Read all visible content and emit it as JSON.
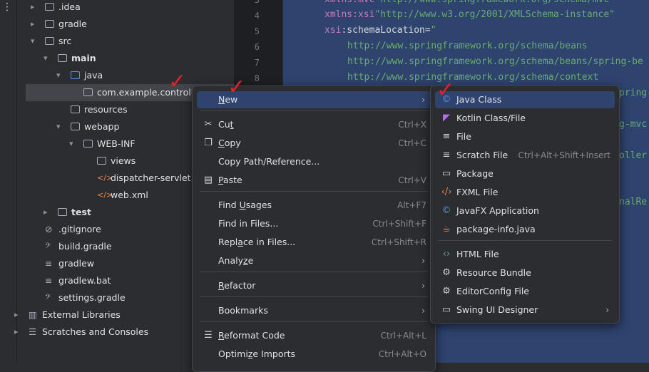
{
  "tree": [
    {
      "label": ".idea",
      "arrow": "›",
      "icon": "folder-icon"
    },
    {
      "label": "gradle",
      "arrow": "›",
      "icon": "folder-icon"
    },
    {
      "label": "src",
      "arrow": "⌄",
      "icon": "folder-icon"
    },
    {
      "label": "main",
      "arrow": "⌄",
      "icon": "folder-icon"
    },
    {
      "label": "java",
      "arrow": "⌄",
      "icon": "source-folder-icon"
    },
    {
      "label": "com.example.controll",
      "arrow": "",
      "icon": "package-icon"
    },
    {
      "label": "resources",
      "arrow": "",
      "icon": "resources-folder-icon"
    },
    {
      "label": "webapp",
      "arrow": "⌄",
      "icon": "folder-icon"
    },
    {
      "label": "WEB-INF",
      "arrow": "⌄",
      "icon": "folder-icon"
    },
    {
      "label": "views",
      "arrow": "",
      "icon": "folder-icon"
    },
    {
      "label": "dispatcher-servlet.x",
      "arrow": "",
      "icon": "xml-icon"
    },
    {
      "label": "web.xml",
      "arrow": "",
      "icon": "xml-icon"
    },
    {
      "label": "test",
      "arrow": "›",
      "icon": "folder-icon"
    },
    {
      "label": ".gitignore",
      "arrow": "",
      "icon": "gitignore-icon"
    },
    {
      "label": "build.gradle",
      "arrow": "",
      "icon": "gradle-icon"
    },
    {
      "label": "gradlew",
      "arrow": "",
      "icon": "file-icon"
    },
    {
      "label": "gradlew.bat",
      "arrow": "",
      "icon": "file-icon"
    },
    {
      "label": "settings.gradle",
      "arrow": "",
      "icon": "gradle-icon"
    },
    {
      "label": "External Libraries",
      "arrow": "›",
      "icon": "library-icon"
    },
    {
      "label": "Scratches and Consoles",
      "arrow": "›",
      "icon": "scratches-icon"
    }
  ],
  "gutter": [
    "3",
    "4",
    "5",
    "6",
    "7",
    "8"
  ],
  "code": [
    {
      "attr": "xmlns:",
      "name": "mvc",
      "val": "\"http://www.springframework.org/schema/mvc\""
    },
    {
      "attr": "xmlns:",
      "name": "xsi",
      "val": "\"http://www.w3.org/2001/XMLSchema-instance\""
    },
    {
      "attr": "xsi",
      "name": ":schemaLocation=",
      "val": "\""
    },
    {
      "attr": "",
      "name": "",
      "val": "http://www.springframework.org/schema/beans"
    },
    {
      "attr": "",
      "name": "",
      "val": "http://www.springframework.org/schema/beans/spring-be"
    },
    {
      "attr": "",
      "name": "",
      "val": "http://www.springframework.org/schema/context"
    },
    {
      "attr": "",
      "name": "",
      "val": "pring-"
    },
    {
      "attr": "",
      "name": "",
      "val": "g-mvc."
    },
    {
      "attr": "",
      "name": "",
      "val": "oller"
    },
    {
      "attr": "",
      "name": "",
      "val": "nalRe"
    }
  ],
  "context_menu": [
    {
      "label": "New",
      "mnemonic": "N",
      "shortcut": "",
      "submenu": true,
      "icon": ""
    },
    {
      "label": "Cut",
      "mnemonic": "t",
      "shortcut": "Ctrl+X",
      "submenu": false,
      "icon": "scissors-icon"
    },
    {
      "label": "Copy",
      "mnemonic": "C",
      "shortcut": "Ctrl+C",
      "submenu": false,
      "icon": "copy-icon"
    },
    {
      "label": "Copy Path/Reference...",
      "mnemonic": "",
      "shortcut": "",
      "submenu": false,
      "icon": ""
    },
    {
      "label": "Paste",
      "mnemonic": "P",
      "shortcut": "Ctrl+V",
      "submenu": false,
      "icon": "paste-icon"
    },
    {
      "label": "Find Usages",
      "mnemonic": "U",
      "shortcut": "Alt+F7",
      "submenu": false,
      "icon": ""
    },
    {
      "label": "Find in Files...",
      "mnemonic": "",
      "shortcut": "Ctrl+Shift+F",
      "submenu": false,
      "icon": ""
    },
    {
      "label": "Replace in Files...",
      "mnemonic": "a",
      "shortcut": "Ctrl+Shift+R",
      "submenu": false,
      "icon": ""
    },
    {
      "label": "Analyze",
      "mnemonic": "z",
      "shortcut": "",
      "submenu": true,
      "icon": ""
    },
    {
      "label": "Refactor",
      "mnemonic": "R",
      "shortcut": "",
      "submenu": true,
      "icon": ""
    },
    {
      "label": "Bookmarks",
      "mnemonic": "",
      "shortcut": "",
      "submenu": true,
      "icon": ""
    },
    {
      "label": "Reformat Code",
      "mnemonic": "R",
      "shortcut": "Ctrl+Alt+L",
      "submenu": false,
      "icon": "reformat-icon"
    },
    {
      "label": "Optimize Imports",
      "mnemonic": "z",
      "shortcut": "Ctrl+Alt+O",
      "submenu": false,
      "icon": ""
    }
  ],
  "new_submenu": [
    {
      "label": "Java Class",
      "shortcut": "",
      "icon": "java-class-icon",
      "submenu": false
    },
    {
      "label": "Kotlin Class/File",
      "shortcut": "",
      "icon": "kotlin-icon",
      "submenu": false
    },
    {
      "label": "File",
      "shortcut": "",
      "icon": "file-icon",
      "submenu": false
    },
    {
      "label": "Scratch File",
      "shortcut": "Ctrl+Alt+Shift+Insert",
      "icon": "scratch-file-icon",
      "submenu": false
    },
    {
      "label": "Package",
      "shortcut": "",
      "icon": "package-icon",
      "submenu": false
    },
    {
      "label": "FXML File",
      "shortcut": "",
      "icon": "fxml-icon",
      "submenu": false
    },
    {
      "label": "JavaFX Application",
      "shortcut": "",
      "icon": "javafx-icon",
      "submenu": false
    },
    {
      "label": "package-info.java",
      "shortcut": "",
      "icon": "package-info-icon",
      "submenu": false
    },
    {
      "label": "HTML File",
      "shortcut": "",
      "icon": "html-icon",
      "submenu": false
    },
    {
      "label": "Resource Bundle",
      "shortcut": "",
      "icon": "resource-bundle-icon",
      "submenu": false
    },
    {
      "label": "EditorConfig File",
      "shortcut": "",
      "icon": "editorconfig-icon",
      "submenu": false
    },
    {
      "label": "Swing UI Designer",
      "shortcut": "",
      "icon": "swing-designer-icon",
      "submenu": true
    }
  ],
  "colors": {
    "accent": "#2e436e",
    "annotation_check": "#e5202a"
  }
}
